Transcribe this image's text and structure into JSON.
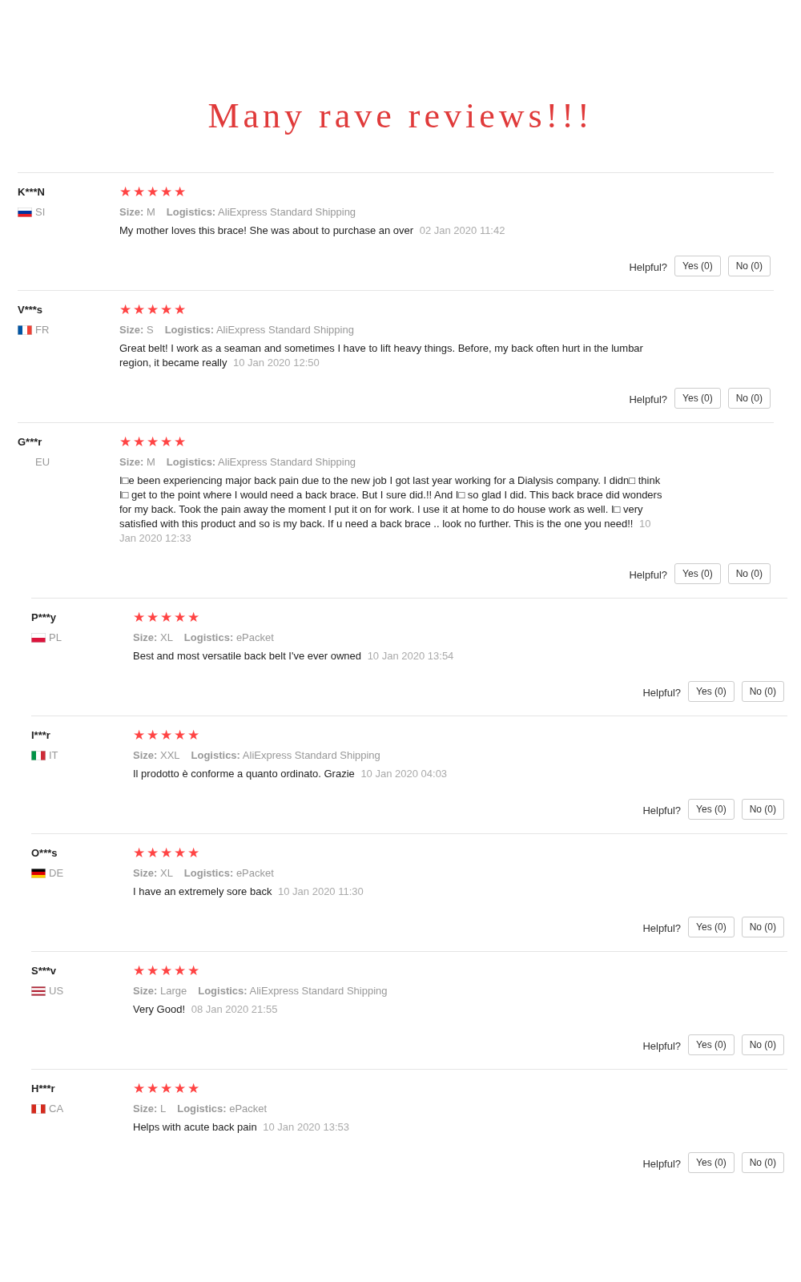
{
  "heading": "Many rave reviews!!!",
  "reviews": [
    {
      "name": "K***N",
      "country": "SI",
      "flag": {
        "kind": "si"
      },
      "stars": 5,
      "size_label": "Size:",
      "size": "M",
      "logistics_label": "Logistics:",
      "logistics": "AliExpress Standard Shipping",
      "text": "My mother loves this brace! She was about to purchase an over",
      "date": "02 Jan 2020 11:42",
      "helpful": "Helpful?",
      "yes": "Yes (0)",
      "no": "No (0)"
    },
    {
      "name": "V***s",
      "country": "FR",
      "flag": {
        "kind": "fr"
      },
      "stars": 5,
      "size_label": "Size:",
      "size": "S",
      "logistics_label": "Logistics:",
      "logistics": "AliExpress Standard Shipping",
      "text": "Great belt! I work as a seaman and sometimes I have to lift heavy things. Before, my back often hurt in the lumbar region, it became really",
      "date": "10 Jan 2020 12:50",
      "helpful": "Helpful?",
      "yes": "Yes (0)",
      "no": "No (0)"
    },
    {
      "name": "G***r",
      "country": "EU",
      "stars": 5,
      "size_label": "Size:",
      "size": "M",
      "logistics_label": "Logistics:",
      "logistics": "AliExpress Standard Shipping",
      "text": "I□e been experiencing major back pain due to the new job I got last year working for a Dialysis company. I didn□ think I□ get to the point where I would need a back brace. But I sure did.!! And I□ so glad I did. This back brace did wonders for my back. Took the pain away the moment I put it on for work. I use it at home to do house work as well. I□ very satisfied with this product and so is my back. If u need a back brace .. look no further. This is the one you need!!",
      "date": "10 Jan 2020 12:33",
      "helpful": "Helpful?",
      "yes": "Yes (0)",
      "no": "No (0)"
    }
  ],
  "more_reviews": [
    {
      "name": "P***y",
      "country": "PL",
      "flag": {
        "kind": "pl"
      },
      "stars": 5,
      "size_label": "Size:",
      "size": "XL",
      "logistics_label": "Logistics:",
      "logistics": "ePacket",
      "text": "Best and most versatile back belt I've ever owned",
      "date": "10 Jan 2020 13:54",
      "helpful": "Helpful?",
      "yes": "Yes (0)",
      "no": "No (0)"
    },
    {
      "name": "I***r",
      "country": "IT",
      "flag": {
        "kind": "it"
      },
      "stars": 5,
      "size_label": "Size:",
      "size": "XXL",
      "logistics_label": "Logistics:",
      "logistics": "AliExpress Standard Shipping",
      "text": "Il prodotto è conforme a quanto ordinato. Grazie",
      "date": "10 Jan 2020 04:03",
      "helpful": "Helpful?",
      "yes": "Yes (0)",
      "no": "No (0)"
    },
    {
      "name": "O***s",
      "country": "DE",
      "flag": {
        "kind": "de"
      },
      "stars": 5,
      "size_label": "Size:",
      "size": "XL",
      "logistics_label": "Logistics:",
      "logistics": "ePacket",
      "text": "I have an extremely sore back",
      "date": "10 Jan 2020 11:30",
      "helpful": "Helpful?",
      "yes": "Yes (0)",
      "no": "No (0)"
    },
    {
      "name": "S***v",
      "country": "US",
      "flag": {
        "kind": "us"
      },
      "stars": 5,
      "size_label": "Size:",
      "size": "Large",
      "logistics_label": "Logistics:",
      "logistics": "AliExpress Standard Shipping",
      "text": "Very Good!",
      "date": "08 Jan 2020 21:55",
      "helpful": "Helpful?",
      "yes": "Yes (0)",
      "no": "No (0)"
    },
    {
      "name": "H***r",
      "country": "CA",
      "flag": {
        "kind": "ca"
      },
      "stars": 5,
      "size_label": "Size:",
      "size": "L",
      "logistics_label": "Logistics:",
      "logistics": "ePacket",
      "text": "Helps with acute back pain",
      "date": "10 Jan 2020 13:53",
      "helpful": "Helpful?",
      "yes": "Yes (0)",
      "no": "No (0)"
    }
  ]
}
